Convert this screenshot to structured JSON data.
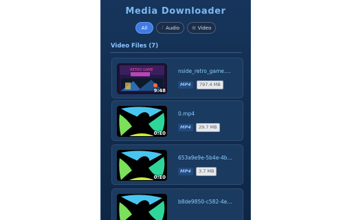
{
  "app": {
    "title": "Media Downloader"
  },
  "filters": [
    {
      "label": "All",
      "icon": "",
      "active": true
    },
    {
      "label": "Audio",
      "icon": "music-icon",
      "active": false
    },
    {
      "label": "Video",
      "icon": "film-icon",
      "active": false
    }
  ],
  "section": {
    "title": "Video Files (7)"
  },
  "items": [
    {
      "name": "nside_retro_game.…",
      "format": "MP4",
      "size": "797.4 MB",
      "duration": "9:48",
      "thumbnail": "retro-game-screenshot"
    },
    {
      "name": "0.mp4",
      "format": "MP4",
      "size": "29.7 MB",
      "duration": "0:10",
      "thumbnail": "colorful-logo"
    },
    {
      "name": "653a9e9e-5b4e-4b…",
      "format": "MP4",
      "size": "3.7 MB",
      "duration": "0:10",
      "thumbnail": "colorful-logo"
    },
    {
      "name": "b8de9850-c582-4e…",
      "format": "MP4",
      "size": "",
      "duration": "",
      "thumbnail": "colorful-logo"
    }
  ],
  "colors": {
    "accent": "#3f7be3",
    "panel": "#15325a",
    "title": "#79b9f3"
  }
}
